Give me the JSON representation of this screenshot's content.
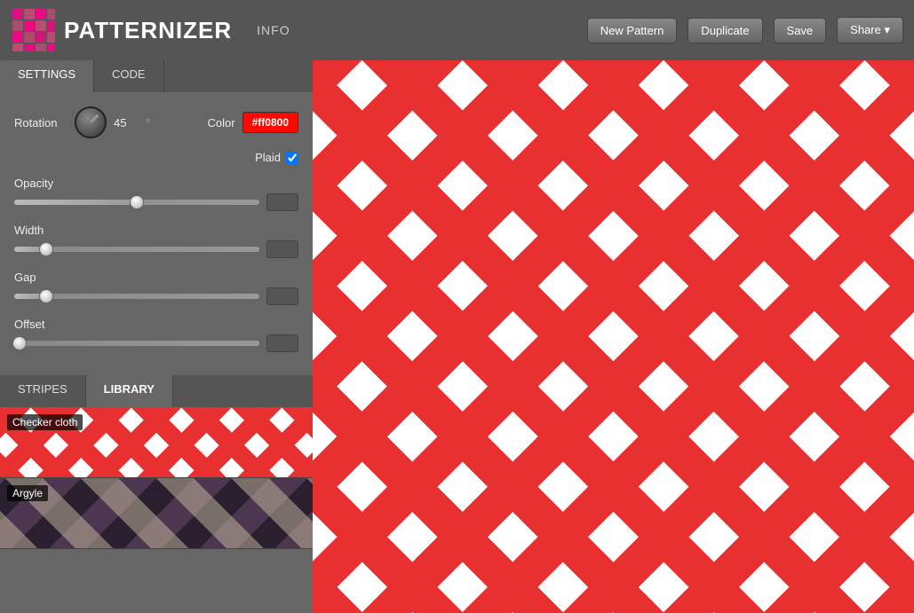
{
  "header": {
    "logo_text": "PATTERNIZER",
    "info_label": "INFO",
    "new_pattern_label": "New Pattern",
    "duplicate_label": "Duplicate",
    "save_label": "Save",
    "share_label": "Share ▾"
  },
  "settings_tabs": {
    "settings_label": "SETTINGS",
    "code_label": "CODE"
  },
  "controls": {
    "rotation_label": "Rotation",
    "rotation_value": "45",
    "degree_symbol": "°",
    "color_label": "Color",
    "color_value": "#ff0800",
    "plaid_label": "Plaid",
    "opacity_label": "Opacity",
    "opacity_value": "50",
    "width_label": "Width",
    "width_value": "45",
    "gap_label": "Gap",
    "gap_value": "45",
    "offset_label": "Offset",
    "offset_value": "0"
  },
  "bottom_tabs": {
    "stripes_label": "STRIPES",
    "library_label": "LIBRARY"
  },
  "library": {
    "items": [
      {
        "name": "checker-cloth",
        "label": "Checker cloth"
      },
      {
        "name": "argyle",
        "label": "Argyle"
      }
    ]
  }
}
